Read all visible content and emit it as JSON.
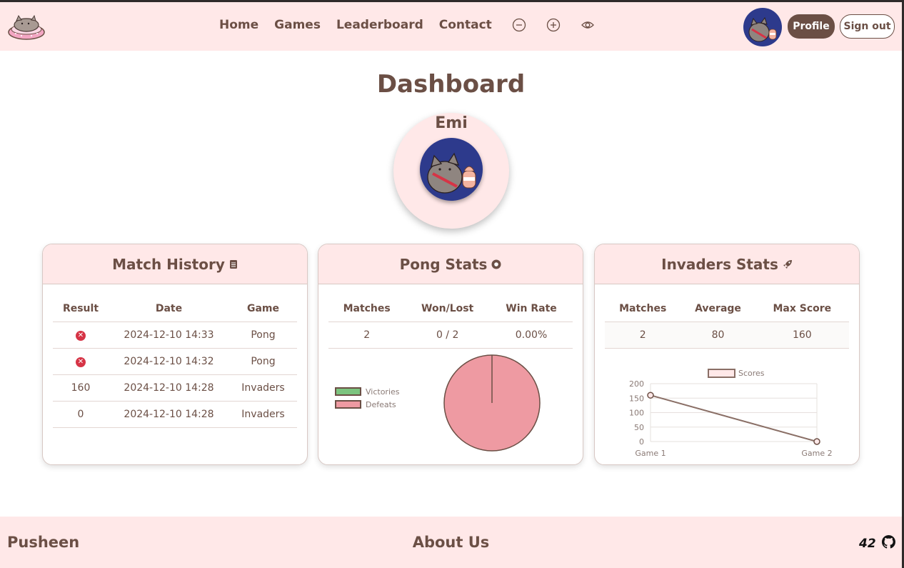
{
  "nav": {
    "links": [
      "Home",
      "Games",
      "Leaderboard",
      "Contact"
    ],
    "icons": [
      "zoom-out-icon",
      "zoom-in-icon",
      "eye-icon"
    ],
    "profile_label": "Profile",
    "signout_label": "Sign out"
  },
  "page": {
    "title": "Dashboard",
    "username": "Emi"
  },
  "match_history": {
    "title": "Match History",
    "icon": "document-icon",
    "columns": [
      "Result",
      "Date",
      "Game"
    ],
    "rows": [
      {
        "result": "fail",
        "date": "2024-12-10 14:33",
        "game": "Pong"
      },
      {
        "result": "fail",
        "date": "2024-12-10 14:32",
        "game": "Pong"
      },
      {
        "result": "160",
        "date": "2024-12-10 14:28",
        "game": "Invaders"
      },
      {
        "result": "0",
        "date": "2024-12-10 14:28",
        "game": "Invaders"
      }
    ]
  },
  "pong_stats": {
    "title": "Pong Stats",
    "icon": "ball-icon",
    "columns": [
      "Matches",
      "Won/Lost",
      "Win Rate"
    ],
    "values": [
      "2",
      "0 / 2",
      "0.00%"
    ]
  },
  "invaders_stats": {
    "title": "Invaders Stats",
    "icon": "rocket-icon",
    "columns": [
      "Matches",
      "Average",
      "Max Score"
    ],
    "values": [
      "2",
      "80",
      "160"
    ]
  },
  "chart_data": [
    {
      "type": "pie",
      "categories": [
        "Victories",
        "Defeats"
      ],
      "values": [
        0,
        2
      ],
      "colors": [
        "#7cc47f",
        "#ee9aa2"
      ],
      "legend_position": "left"
    },
    {
      "type": "line",
      "categories": [
        "Game 1",
        "Game 2"
      ],
      "series": [
        {
          "name": "Scores",
          "values": [
            160,
            0
          ]
        }
      ],
      "ylim": [
        0,
        200
      ],
      "yticks": [
        0,
        50,
        100,
        150,
        200
      ],
      "grid": true,
      "legend_position": "top",
      "colors": [
        "#8a6f66"
      ]
    }
  ],
  "footer": {
    "brand": "Pusheen",
    "about": "About Us",
    "icons": [
      "42-logo-icon",
      "github-icon"
    ]
  },
  "colors": {
    "accent": "#6b4f45",
    "background_pink": "#ffe8e8",
    "avatar_blue": "#2d3a8c",
    "fail_red": "#d63446"
  }
}
